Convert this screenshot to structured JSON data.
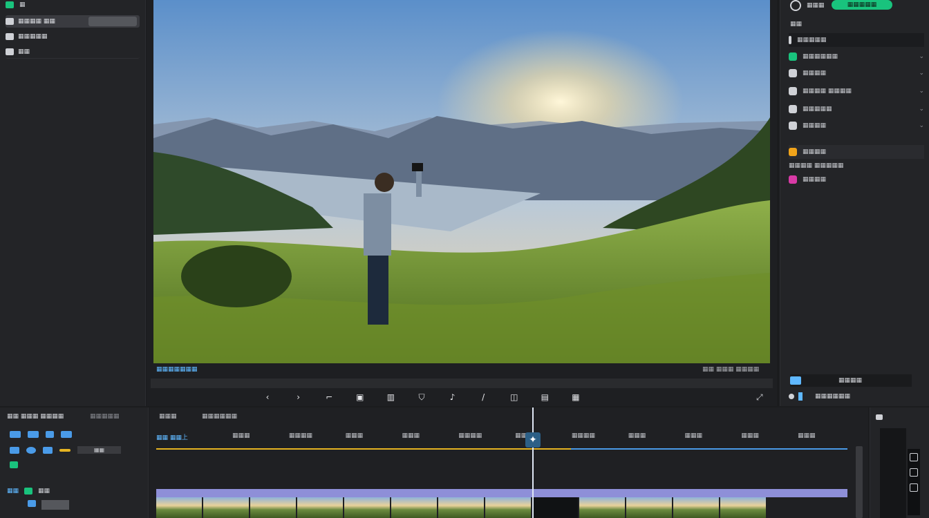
{
  "left_panel": {
    "items": [
      {
        "label": "▦▦▦▦ ▦▦",
        "icon": "media-icon"
      },
      {
        "label": "▦▦▦▦▦",
        "icon": "folder-icon"
      },
      {
        "label": "▦▦",
        "icon": "layers-icon"
      }
    ],
    "header_glyph": "▦"
  },
  "viewer": {
    "scrub_label": "▦▦▦▦▦▦▦",
    "timecode": "▦▦ ▦▦▦ ▦▦▦▦"
  },
  "right_panel": {
    "top_label": "▦▦▦",
    "primary_button": "▦▦▦▦▦",
    "section_title": "▦▦",
    "items": [
      {
        "label": "▦▦▦▦▦",
        "color": "#2c2d31"
      },
      {
        "label": "▦▦▦▦▦▦",
        "color": "#19c37d"
      },
      {
        "label": "▦▦▦▦",
        "color": "#3a3b3f"
      },
      {
        "label": "▦▦▦▦ ▦▦▦▦",
        "color": "#3a3b3f"
      },
      {
        "label": "▦▦▦▦▦",
        "color": "#3a3b3f"
      },
      {
        "label": "▦▦▦▦",
        "color": "#3a3b3f"
      },
      {
        "label": "▦▦▦▦",
        "color": "#f0a31a"
      },
      {
        "label": "▦▦▦▦ ▦▦▦▦▦",
        "color": "#2c2d31"
      },
      {
        "label": "▦▦▦▦",
        "color": "#d83aa6"
      }
    ],
    "footer_label": "▦▦▦▦",
    "footer_label2": "▦▦▦▦▦▦"
  },
  "bottom_left": {
    "title": "▦▦ ▦▦▦ ▦▦▦▦",
    "subtitle": "▦▦▦▦▦",
    "badge": "▦▦",
    "row_label": "▦▦"
  },
  "timeline": {
    "tabs": [
      "▦▦▦",
      "▦▦▦▦▦▦"
    ],
    "track_title": "▦▦ ▦▦上",
    "markers": [
      "▦▦▦",
      "▦▦▦▦",
      "▦▦▦",
      "▦▦▦",
      "▦▦▦▦",
      "▦▦▦",
      "▦▦▦▦",
      "▦▦▦",
      "▦▦▦",
      "▦▦▦",
      "▦▦▦"
    ]
  },
  "colors": {
    "accent": "#19c37d",
    "playhead": "#2c5f86",
    "clip": "#8e8fd8",
    "ruler": "#e6b422"
  }
}
